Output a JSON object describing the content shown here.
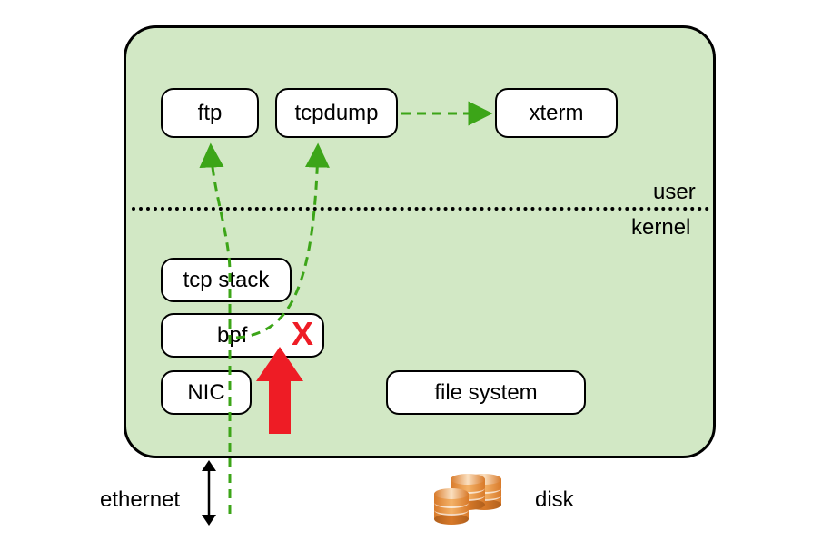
{
  "boxes": {
    "ftp": "ftp",
    "tcpdump": "tcpdump",
    "xterm": "xterm",
    "tcpstack": "tcp stack",
    "bpf": "bpf",
    "nic": "NIC",
    "filesystem": "file system"
  },
  "labels": {
    "user": "user",
    "kernel": "kernel",
    "ethernet": "ethernet",
    "disk": "disk",
    "x_mark": "X"
  },
  "colors": {
    "container_bg": "#d2e8c5",
    "arrow_green": "#3ca518",
    "arrow_red": "#ee1c25",
    "cylinder": "#e8954a"
  }
}
